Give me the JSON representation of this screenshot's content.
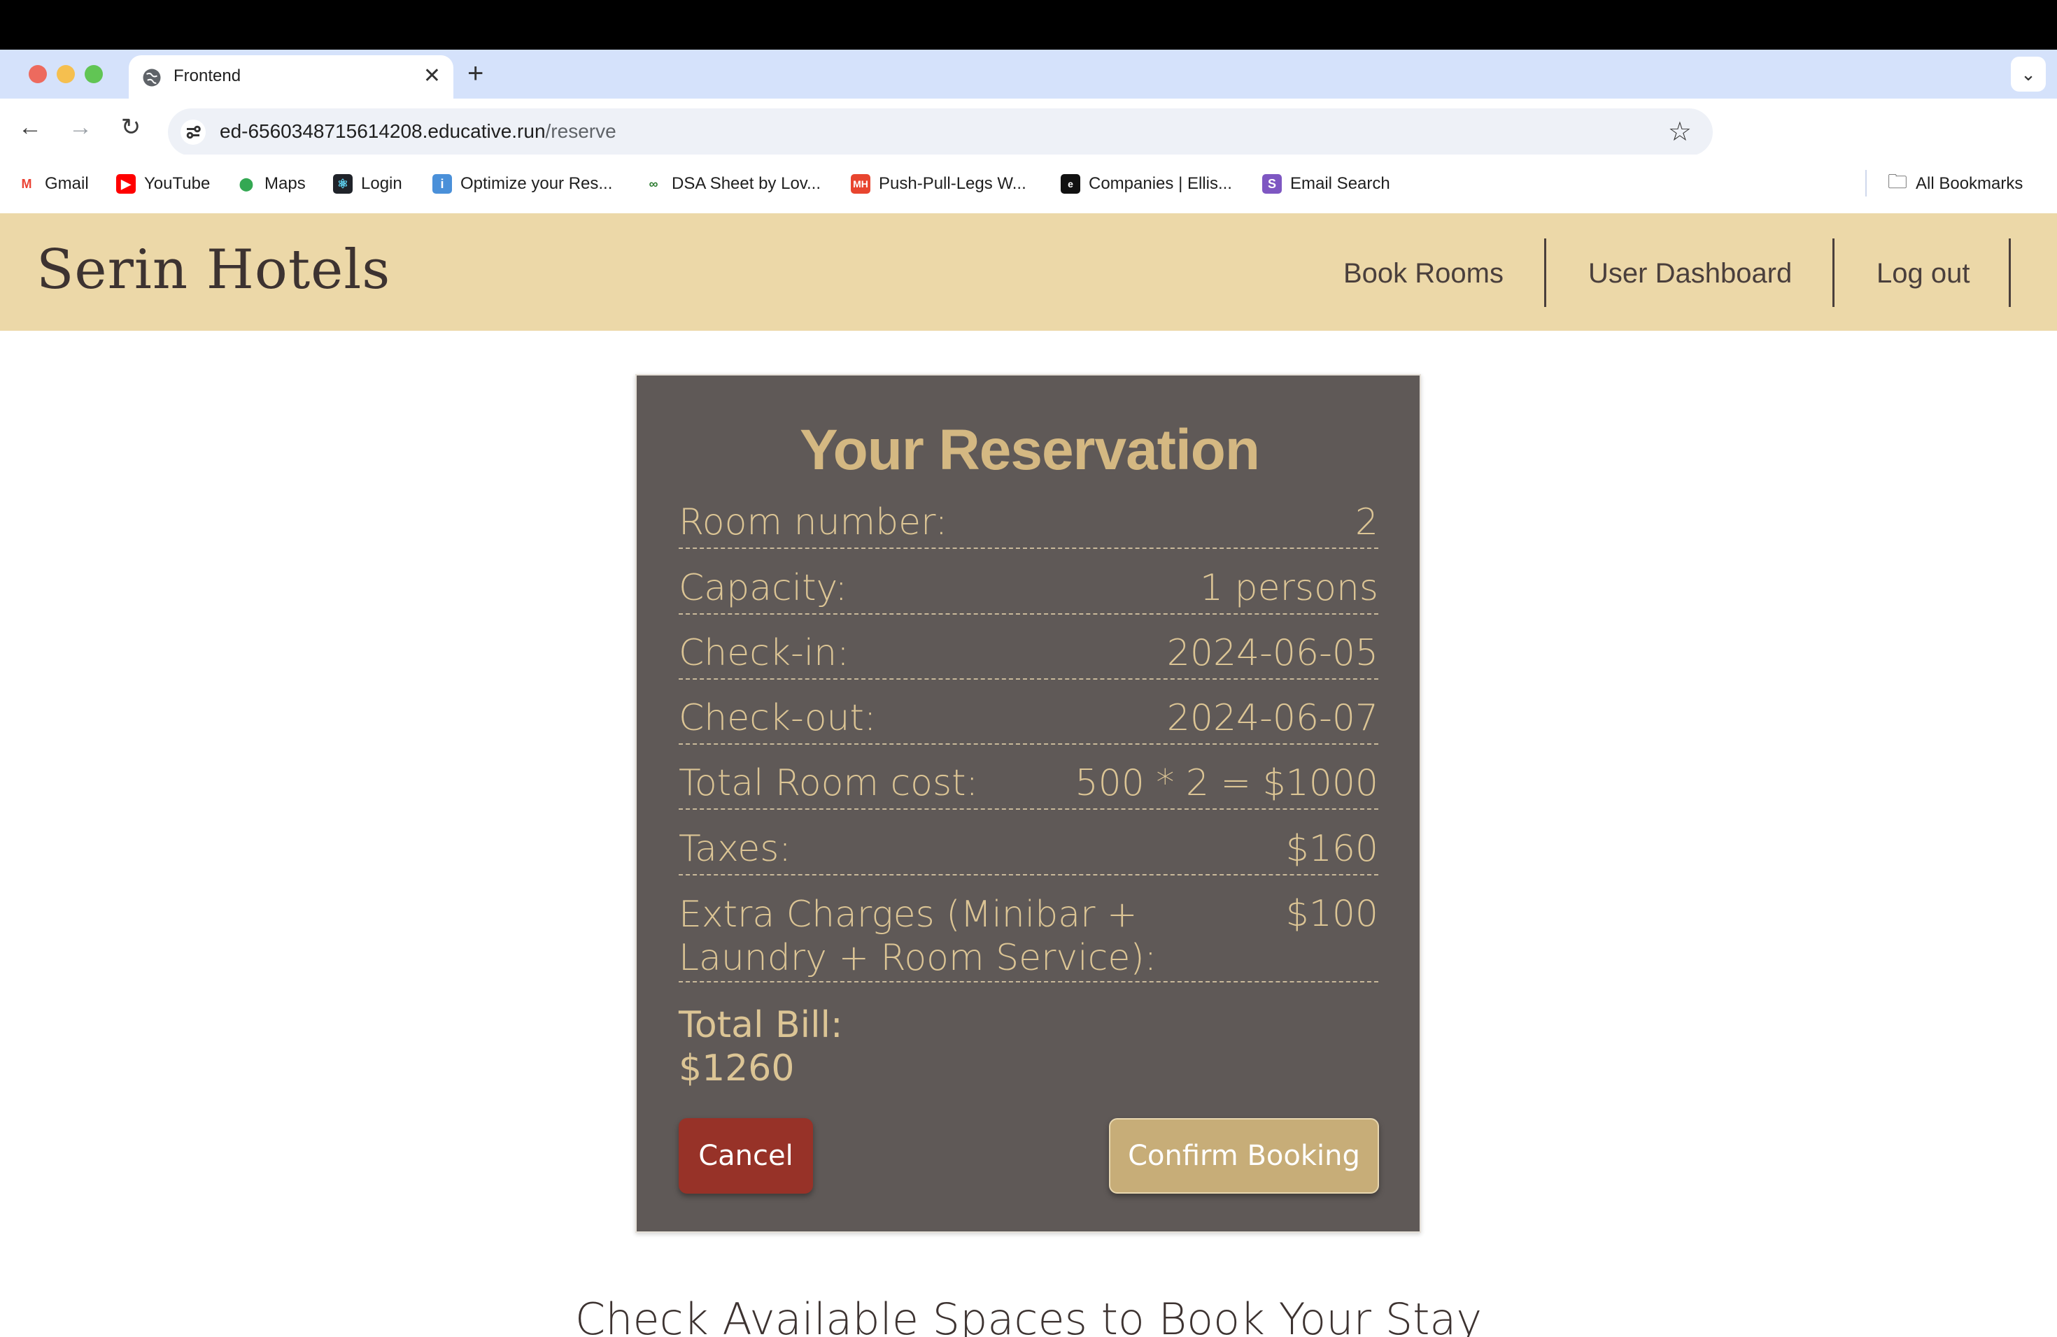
{
  "browser": {
    "tab_title": "Frontend",
    "url_host": "ed-6560348715614208.educative.run",
    "url_path": "/reserve",
    "bookmarks": [
      {
        "label": "Gmail",
        "icon": "gmail-icon",
        "color": "#ea4335"
      },
      {
        "label": "YouTube",
        "icon": "youtube-icon",
        "color": "#ff0000"
      },
      {
        "label": "Maps",
        "icon": "maps-icon",
        "color": "#34a853"
      },
      {
        "label": "Login",
        "icon": "react-icon",
        "color": "#20232a"
      },
      {
        "label": "Optimize your Res...",
        "icon": "tie-icon",
        "color": "#4a90d9"
      },
      {
        "label": "DSA Sheet by Lov...",
        "icon": "infinity-icon",
        "color": "#2e7d32"
      },
      {
        "label": "Push-Pull-Legs W...",
        "icon": "mh-icon",
        "color": "#e8452f"
      },
      {
        "label": "Companies | Ellis...",
        "icon": "ellis-icon",
        "color": "#111111"
      },
      {
        "label": "Email Search",
        "icon": "s-icon",
        "color": "#7e57c2"
      }
    ],
    "all_bookmarks": "All Bookmarks"
  },
  "site": {
    "brand": "Serin Hotels",
    "nav": [
      "Book Rooms",
      "User Dashboard",
      "Log out"
    ],
    "header_color": "#ecd8a8"
  },
  "reservation": {
    "title": "Your Reservation",
    "rows": [
      {
        "label": "Room number:",
        "value": "2"
      },
      {
        "label": "Capacity:",
        "value": "1 persons"
      },
      {
        "label": "Check-in:",
        "value": "2024-06-05"
      },
      {
        "label": "Check-out:",
        "value": "2024-06-07"
      },
      {
        "label": "Total Room cost:",
        "value": "500 * 2 = $1000"
      },
      {
        "label": "Taxes:",
        "value": "$160"
      },
      {
        "label": "Extra Charges (Minibar + Laundry + Room Service):",
        "value": "$100"
      }
    ],
    "total_label": "Total Bill:",
    "total_value": "$1260",
    "cancel_label": "Cancel",
    "confirm_label": "Confirm Booking",
    "accent_color": "#d4b882"
  },
  "subheading": "Check Available Spaces to Book Your Stay"
}
